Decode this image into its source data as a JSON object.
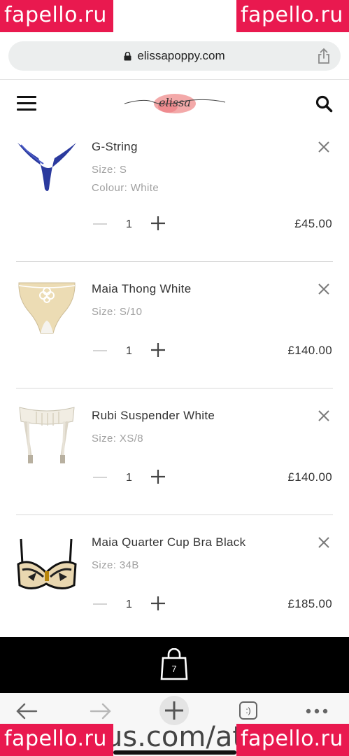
{
  "watermark": {
    "left_text": "fapello.ru",
    "right_text": "fapello.ru"
  },
  "browser": {
    "url": "elissapoppy.com",
    "bottom_url_fragment": "us.com/ath",
    "tab_count_label": ":)"
  },
  "header": {
    "logo_text": "elissa"
  },
  "cart": {
    "items": [
      {
        "title": "G-String",
        "size": "Size: S",
        "colour": "Colour: White",
        "quantity": "1",
        "price": "£45.00"
      },
      {
        "title": "Maia Thong White",
        "size": "Size: S/10",
        "quantity": "1",
        "price": "£140.00"
      },
      {
        "title": "Rubi Suspender White",
        "size": "Size: XS/8",
        "quantity": "1",
        "price": "£140.00"
      },
      {
        "title": "Maia Quarter Cup Bra Black",
        "size": "Size: 34B",
        "quantity": "1",
        "price": "£185.00"
      }
    ],
    "bag_count": "7"
  },
  "colors": {
    "watermark": "#e9194f",
    "g_string_blue": "#2b3a9e",
    "checkout_bar": "#000000"
  }
}
